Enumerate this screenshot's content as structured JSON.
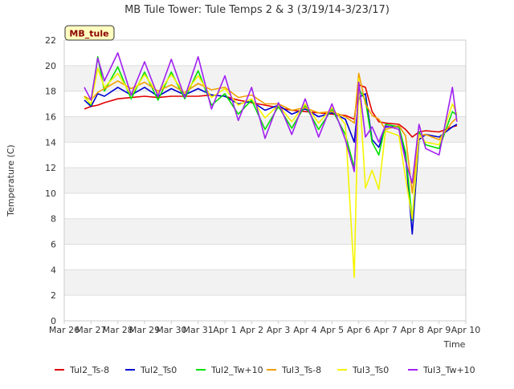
{
  "chart_data": {
    "type": "line",
    "title": "MB Tule Tower: Tule Temps 2 & 3 (3/19/14-3/23/17)",
    "xlabel": "Time",
    "ylabel": "Temperature (C)",
    "site_label": "MB_tule",
    "ylim": [
      0,
      22
    ],
    "yticks": [
      0,
      2,
      4,
      6,
      8,
      10,
      12,
      14,
      16,
      18,
      20,
      22
    ],
    "xlim": [
      "2017-03-26",
      "2017-04-10"
    ],
    "xticks": [
      {
        "label": "Mar 26",
        "date": "2017-03-26"
      },
      {
        "label": "Mar 27",
        "date": "2017-03-27"
      },
      {
        "label": "Mar 28",
        "date": "2017-03-28"
      },
      {
        "label": "Mar 29",
        "date": "2017-03-29"
      },
      {
        "label": "Mar 30",
        "date": "2017-03-30"
      },
      {
        "label": "Mar 31",
        "date": "2017-03-31"
      },
      {
        "label": "Apr 1",
        "date": "2017-04-01"
      },
      {
        "label": "Apr 2",
        "date": "2017-04-02"
      },
      {
        "label": "Apr 3",
        "date": "2017-04-03"
      },
      {
        "label": "Apr 4",
        "date": "2017-04-04"
      },
      {
        "label": "Apr 5",
        "date": "2017-04-05"
      },
      {
        "label": "Apr 6",
        "date": "2017-04-06"
      },
      {
        "label": "Apr 7",
        "date": "2017-04-07"
      },
      {
        "label": "Apr 8",
        "date": "2017-04-08"
      },
      {
        "label": "Apr 9",
        "date": "2017-04-09"
      },
      {
        "label": "Apr 10",
        "date": "2017-04-10"
      }
    ],
    "grid": true,
    "legend_position": "bottom",
    "series": [
      {
        "name": "Tul2_Ts-8",
        "color": "#e00000",
        "points": [
          [
            "2017-03-26T18:00",
            16.6
          ],
          [
            "2017-03-27T00:00",
            16.8
          ],
          [
            "2017-03-27T06:00",
            16.9
          ],
          [
            "2017-03-27T12:00",
            17.1
          ],
          [
            "2017-03-28T00:00",
            17.4
          ],
          [
            "2017-03-28T12:00",
            17.5
          ],
          [
            "2017-03-29T00:00",
            17.6
          ],
          [
            "2017-03-29T12:00",
            17.5
          ],
          [
            "2017-03-30T00:00",
            17.6
          ],
          [
            "2017-03-30T12:00",
            17.6
          ],
          [
            "2017-03-31T00:00",
            17.6
          ],
          [
            "2017-03-31T12:00",
            17.7
          ],
          [
            "2017-04-01T00:00",
            17.6
          ],
          [
            "2017-04-01T12:00",
            17.3
          ],
          [
            "2017-04-02T00:00",
            17.1
          ],
          [
            "2017-04-02T12:00",
            16.9
          ],
          [
            "2017-04-03T00:00",
            16.7
          ],
          [
            "2017-04-03T12:00",
            16.5
          ],
          [
            "2017-04-04T00:00",
            16.4
          ],
          [
            "2017-04-04T12:00",
            16.3
          ],
          [
            "2017-04-05T00:00",
            16.2
          ],
          [
            "2017-04-05T12:00",
            16.1
          ],
          [
            "2017-04-05T20:00",
            15.8
          ],
          [
            "2017-04-06T00:00",
            18.5
          ],
          [
            "2017-04-06T06:00",
            18.3
          ],
          [
            "2017-04-06T12:00",
            16.4
          ],
          [
            "2017-04-06T18:00",
            15.6
          ],
          [
            "2017-04-07T00:00",
            15.5
          ],
          [
            "2017-04-07T12:00",
            15.4
          ],
          [
            "2017-04-07T18:00",
            15.0
          ],
          [
            "2017-04-08T00:00",
            14.4
          ],
          [
            "2017-04-08T06:00",
            14.8
          ],
          [
            "2017-04-08T12:00",
            14.9
          ],
          [
            "2017-04-09T00:00",
            14.8
          ],
          [
            "2017-04-09T12:00",
            15.2
          ],
          [
            "2017-04-09T16:00",
            15.3
          ]
        ]
      },
      {
        "name": "Tul2_Ts0",
        "color": "#0000d0",
        "points": [
          [
            "2017-03-26T18:00",
            17.3
          ],
          [
            "2017-03-27T00:00",
            16.8
          ],
          [
            "2017-03-27T06:00",
            17.8
          ],
          [
            "2017-03-27T12:00",
            17.6
          ],
          [
            "2017-03-28T00:00",
            18.3
          ],
          [
            "2017-03-28T12:00",
            17.7
          ],
          [
            "2017-03-29T00:00",
            18.3
          ],
          [
            "2017-03-29T12:00",
            17.6
          ],
          [
            "2017-03-30T00:00",
            18.2
          ],
          [
            "2017-03-30T12:00",
            17.7
          ],
          [
            "2017-03-31T00:00",
            18.2
          ],
          [
            "2017-03-31T12:00",
            17.7
          ],
          [
            "2017-04-01T00:00",
            17.6
          ],
          [
            "2017-04-01T12:00",
            17.0
          ],
          [
            "2017-04-02T00:00",
            17.2
          ],
          [
            "2017-04-02T12:00",
            16.5
          ],
          [
            "2017-04-03T00:00",
            16.9
          ],
          [
            "2017-04-03T12:00",
            16.2
          ],
          [
            "2017-04-04T00:00",
            16.6
          ],
          [
            "2017-04-04T12:00",
            16.0
          ],
          [
            "2017-04-05T00:00",
            16.3
          ],
          [
            "2017-04-05T12:00",
            15.8
          ],
          [
            "2017-04-05T20:00",
            14.0
          ],
          [
            "2017-04-06T00:00",
            17.5
          ],
          [
            "2017-04-06T06:00",
            17.8
          ],
          [
            "2017-04-06T12:00",
            14.2
          ],
          [
            "2017-04-06T18:00",
            13.6
          ],
          [
            "2017-04-07T00:00",
            15.2
          ],
          [
            "2017-04-07T12:00",
            15.2
          ],
          [
            "2017-04-07T18:00",
            13.0
          ],
          [
            "2017-04-08T00:00",
            6.8
          ],
          [
            "2017-04-08T06:00",
            14.2
          ],
          [
            "2017-04-08T12:00",
            14.6
          ],
          [
            "2017-04-09T00:00",
            14.4
          ],
          [
            "2017-04-09T12:00",
            15.2
          ],
          [
            "2017-04-09T16:00",
            15.4
          ]
        ]
      },
      {
        "name": "Tul2_Tw+10",
        "color": "#00e000",
        "points": [
          [
            "2017-03-26T18:00",
            17.6
          ],
          [
            "2017-03-27T00:00",
            16.9
          ],
          [
            "2017-03-27T06:00",
            20.7
          ],
          [
            "2017-03-27T12:00",
            18.0
          ],
          [
            "2017-03-28T00:00",
            19.9
          ],
          [
            "2017-03-28T12:00",
            17.4
          ],
          [
            "2017-03-29T00:00",
            19.5
          ],
          [
            "2017-03-29T12:00",
            17.3
          ],
          [
            "2017-03-30T00:00",
            19.5
          ],
          [
            "2017-03-30T12:00",
            17.4
          ],
          [
            "2017-03-31T00:00",
            19.6
          ],
          [
            "2017-03-31T12:00",
            16.9
          ],
          [
            "2017-04-01T00:00",
            17.8
          ],
          [
            "2017-04-01T12:00",
            16.2
          ],
          [
            "2017-04-02T00:00",
            17.3
          ],
          [
            "2017-04-02T12:00",
            15.0
          ],
          [
            "2017-04-03T00:00",
            16.8
          ],
          [
            "2017-04-03T12:00",
            15.1
          ],
          [
            "2017-04-04T00:00",
            16.9
          ],
          [
            "2017-04-04T12:00",
            15.0
          ],
          [
            "2017-04-05T00:00",
            16.6
          ],
          [
            "2017-04-05T12:00",
            14.6
          ],
          [
            "2017-04-05T20:00",
            12.0
          ],
          [
            "2017-04-06T00:00",
            18.2
          ],
          [
            "2017-04-06T06:00",
            17.3
          ],
          [
            "2017-04-06T12:00",
            14.0
          ],
          [
            "2017-04-06T18:00",
            13.0
          ],
          [
            "2017-04-07T00:00",
            15.4
          ],
          [
            "2017-04-07T12:00",
            15.2
          ],
          [
            "2017-04-07T18:00",
            13.2
          ],
          [
            "2017-04-08T00:00",
            7.9
          ],
          [
            "2017-04-08T06:00",
            14.8
          ],
          [
            "2017-04-08T12:00",
            13.8
          ],
          [
            "2017-04-09T00:00",
            13.5
          ],
          [
            "2017-04-09T12:00",
            16.4
          ],
          [
            "2017-04-09T16:00",
            16.1
          ]
        ]
      },
      {
        "name": "Tul3_Ts-8",
        "color": "#f0a000",
        "points": [
          [
            "2017-03-26T18:00",
            17.6
          ],
          [
            "2017-03-27T00:00",
            17.3
          ],
          [
            "2017-03-27T06:00",
            17.9
          ],
          [
            "2017-03-27T12:00",
            18.2
          ],
          [
            "2017-03-28T00:00",
            18.8
          ],
          [
            "2017-03-28T12:00",
            18.2
          ],
          [
            "2017-03-29T00:00",
            18.7
          ],
          [
            "2017-03-29T12:00",
            18.0
          ],
          [
            "2017-03-30T00:00",
            18.5
          ],
          [
            "2017-03-30T12:00",
            17.9
          ],
          [
            "2017-03-31T00:00",
            18.6
          ],
          [
            "2017-03-31T12:00",
            18.1
          ],
          [
            "2017-04-01T00:00",
            18.3
          ],
          [
            "2017-04-01T12:00",
            17.5
          ],
          [
            "2017-04-02T00:00",
            17.7
          ],
          [
            "2017-04-02T12:00",
            17.0
          ],
          [
            "2017-04-03T00:00",
            17.0
          ],
          [
            "2017-04-03T12:00",
            16.5
          ],
          [
            "2017-04-04T00:00",
            16.7
          ],
          [
            "2017-04-04T12:00",
            16.3
          ],
          [
            "2017-04-05T00:00",
            16.4
          ],
          [
            "2017-04-05T12:00",
            16.0
          ],
          [
            "2017-04-05T20:00",
            15.5
          ],
          [
            "2017-04-06T00:00",
            19.4
          ],
          [
            "2017-04-06T06:00",
            17.0
          ],
          [
            "2017-04-06T12:00",
            16.1
          ],
          [
            "2017-04-06T18:00",
            15.8
          ],
          [
            "2017-04-07T00:00",
            15.0
          ],
          [
            "2017-04-07T12:00",
            15.3
          ],
          [
            "2017-04-07T18:00",
            14.5
          ],
          [
            "2017-04-08T00:00",
            10.0
          ],
          [
            "2017-04-08T06:00",
            14.5
          ],
          [
            "2017-04-08T12:00",
            14.6
          ],
          [
            "2017-04-09T00:00",
            14.2
          ],
          [
            "2017-04-09T12:00",
            15.6
          ],
          [
            "2017-04-09T16:00",
            15.9
          ]
        ]
      },
      {
        "name": "Tul3_Ts0",
        "color": "#f5f500",
        "points": [
          [
            "2017-03-26T18:00",
            17.5
          ],
          [
            "2017-03-27T00:00",
            17.0
          ],
          [
            "2017-03-27T06:00",
            19.8
          ],
          [
            "2017-03-27T12:00",
            18.3
          ],
          [
            "2017-03-28T00:00",
            19.4
          ],
          [
            "2017-03-28T12:00",
            17.7
          ],
          [
            "2017-03-29T00:00",
            19.3
          ],
          [
            "2017-03-29T12:00",
            17.8
          ],
          [
            "2017-03-30T00:00",
            19.3
          ],
          [
            "2017-03-30T12:00",
            17.8
          ],
          [
            "2017-03-31T00:00",
            19.2
          ],
          [
            "2017-03-31T12:00",
            17.5
          ],
          [
            "2017-04-01T00:00",
            18.2
          ],
          [
            "2017-04-01T12:00",
            16.9
          ],
          [
            "2017-04-02T00:00",
            17.4
          ],
          [
            "2017-04-02T12:00",
            15.9
          ],
          [
            "2017-04-03T00:00",
            16.9
          ],
          [
            "2017-04-03T12:00",
            15.6
          ],
          [
            "2017-04-04T00:00",
            17.0
          ],
          [
            "2017-04-04T12:00",
            15.5
          ],
          [
            "2017-04-05T00:00",
            16.7
          ],
          [
            "2017-04-05T12:00",
            15.4
          ],
          [
            "2017-04-05T20:00",
            3.4
          ],
          [
            "2017-04-06T00:00",
            19.0
          ],
          [
            "2017-04-06T06:00",
            10.4
          ],
          [
            "2017-04-06T12:00",
            11.8
          ],
          [
            "2017-04-06T18:00",
            10.3
          ],
          [
            "2017-04-07T00:00",
            14.9
          ],
          [
            "2017-04-07T12:00",
            14.5
          ],
          [
            "2017-04-07T18:00",
            11.2
          ],
          [
            "2017-04-08T00:00",
            8.0
          ],
          [
            "2017-04-08T06:00",
            14.6
          ],
          [
            "2017-04-08T12:00",
            14.0
          ],
          [
            "2017-04-09T00:00",
            13.8
          ],
          [
            "2017-04-09T12:00",
            17.0
          ],
          [
            "2017-04-09T16:00",
            16.2
          ]
        ]
      },
      {
        "name": "Tul3_Tw+10",
        "color": "#a020f0",
        "points": [
          [
            "2017-03-26T18:00",
            18.3
          ],
          [
            "2017-03-27T00:00",
            17.3
          ],
          [
            "2017-03-27T06:00",
            20.6
          ],
          [
            "2017-03-27T12:00",
            18.8
          ],
          [
            "2017-03-28T00:00",
            21.0
          ],
          [
            "2017-03-28T12:00",
            17.7
          ],
          [
            "2017-03-29T00:00",
            20.3
          ],
          [
            "2017-03-29T12:00",
            17.6
          ],
          [
            "2017-03-30T00:00",
            20.5
          ],
          [
            "2017-03-30T12:00",
            17.5
          ],
          [
            "2017-03-31T00:00",
            20.7
          ],
          [
            "2017-03-31T12:00",
            16.6
          ],
          [
            "2017-04-01T00:00",
            19.2
          ],
          [
            "2017-04-01T12:00",
            15.7
          ],
          [
            "2017-04-02T00:00",
            18.3
          ],
          [
            "2017-04-02T12:00",
            14.3
          ],
          [
            "2017-04-03T00:00",
            17.1
          ],
          [
            "2017-04-03T12:00",
            14.6
          ],
          [
            "2017-04-04T00:00",
            17.4
          ],
          [
            "2017-04-04T12:00",
            14.4
          ],
          [
            "2017-04-05T00:00",
            17.0
          ],
          [
            "2017-04-05T12:00",
            14.2
          ],
          [
            "2017-04-05T20:00",
            11.7
          ],
          [
            "2017-04-06T00:00",
            18.7
          ],
          [
            "2017-04-06T06:00",
            14.4
          ],
          [
            "2017-04-06T12:00",
            15.2
          ],
          [
            "2017-04-06T18:00",
            14.0
          ],
          [
            "2017-04-07T00:00",
            15.3
          ],
          [
            "2017-04-07T12:00",
            15.0
          ],
          [
            "2017-04-07T18:00",
            12.5
          ],
          [
            "2017-04-08T00:00",
            10.8
          ],
          [
            "2017-04-08T06:00",
            15.4
          ],
          [
            "2017-04-08T12:00",
            13.5
          ],
          [
            "2017-04-09T00:00",
            13.0
          ],
          [
            "2017-04-09T12:00",
            18.3
          ],
          [
            "2017-04-09T16:00",
            15.6
          ]
        ]
      }
    ]
  }
}
